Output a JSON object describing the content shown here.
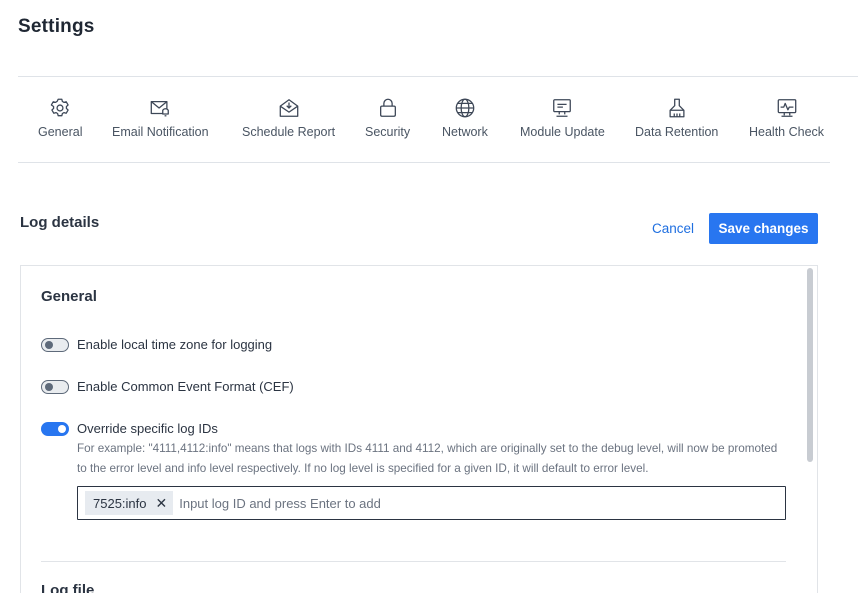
{
  "page": {
    "title": "Settings"
  },
  "nav": {
    "items": [
      {
        "label": "General",
        "icon": "gear-icon"
      },
      {
        "label": "Email Notification",
        "icon": "email-notification-icon"
      },
      {
        "label": "Schedule Report",
        "icon": "schedule-report-icon"
      },
      {
        "label": "Security",
        "icon": "lock-icon"
      },
      {
        "label": "Network",
        "icon": "globe-icon"
      },
      {
        "label": "Module Update",
        "icon": "module-update-icon"
      },
      {
        "label": "Data Retention",
        "icon": "data-retention-icon"
      },
      {
        "label": "Health Check",
        "icon": "health-check-icon"
      }
    ]
  },
  "section": {
    "title": "Log details",
    "cancel_label": "Cancel",
    "save_label": "Save changes"
  },
  "general": {
    "title": "General",
    "toggles": [
      {
        "label": "Enable local time zone for logging",
        "on": false
      },
      {
        "label": "Enable Common Event Format (CEF)",
        "on": false
      },
      {
        "label": "Override specific log IDs",
        "on": true
      }
    ],
    "override_help": "For example: \"4111,4112:info\" means that logs with IDs 4111 and 4112, which are originally set to the debug level, will now be promoted to the error level and info level respectively. If no log level is specified for a given ID, it will default to error level.",
    "tag_input": {
      "tags": [
        "7525:info"
      ],
      "remove_icon": "close-icon",
      "placeholder": "Input log ID and press Enter to add"
    }
  },
  "log_file": {
    "title": "Log file"
  },
  "colors": {
    "accent": "#2876f0",
    "link": "#1f6fe0",
    "text": "#2b3442",
    "muted": "#6b7380",
    "border": "#e1e4e8",
    "chip_bg": "#e7ebf0"
  }
}
